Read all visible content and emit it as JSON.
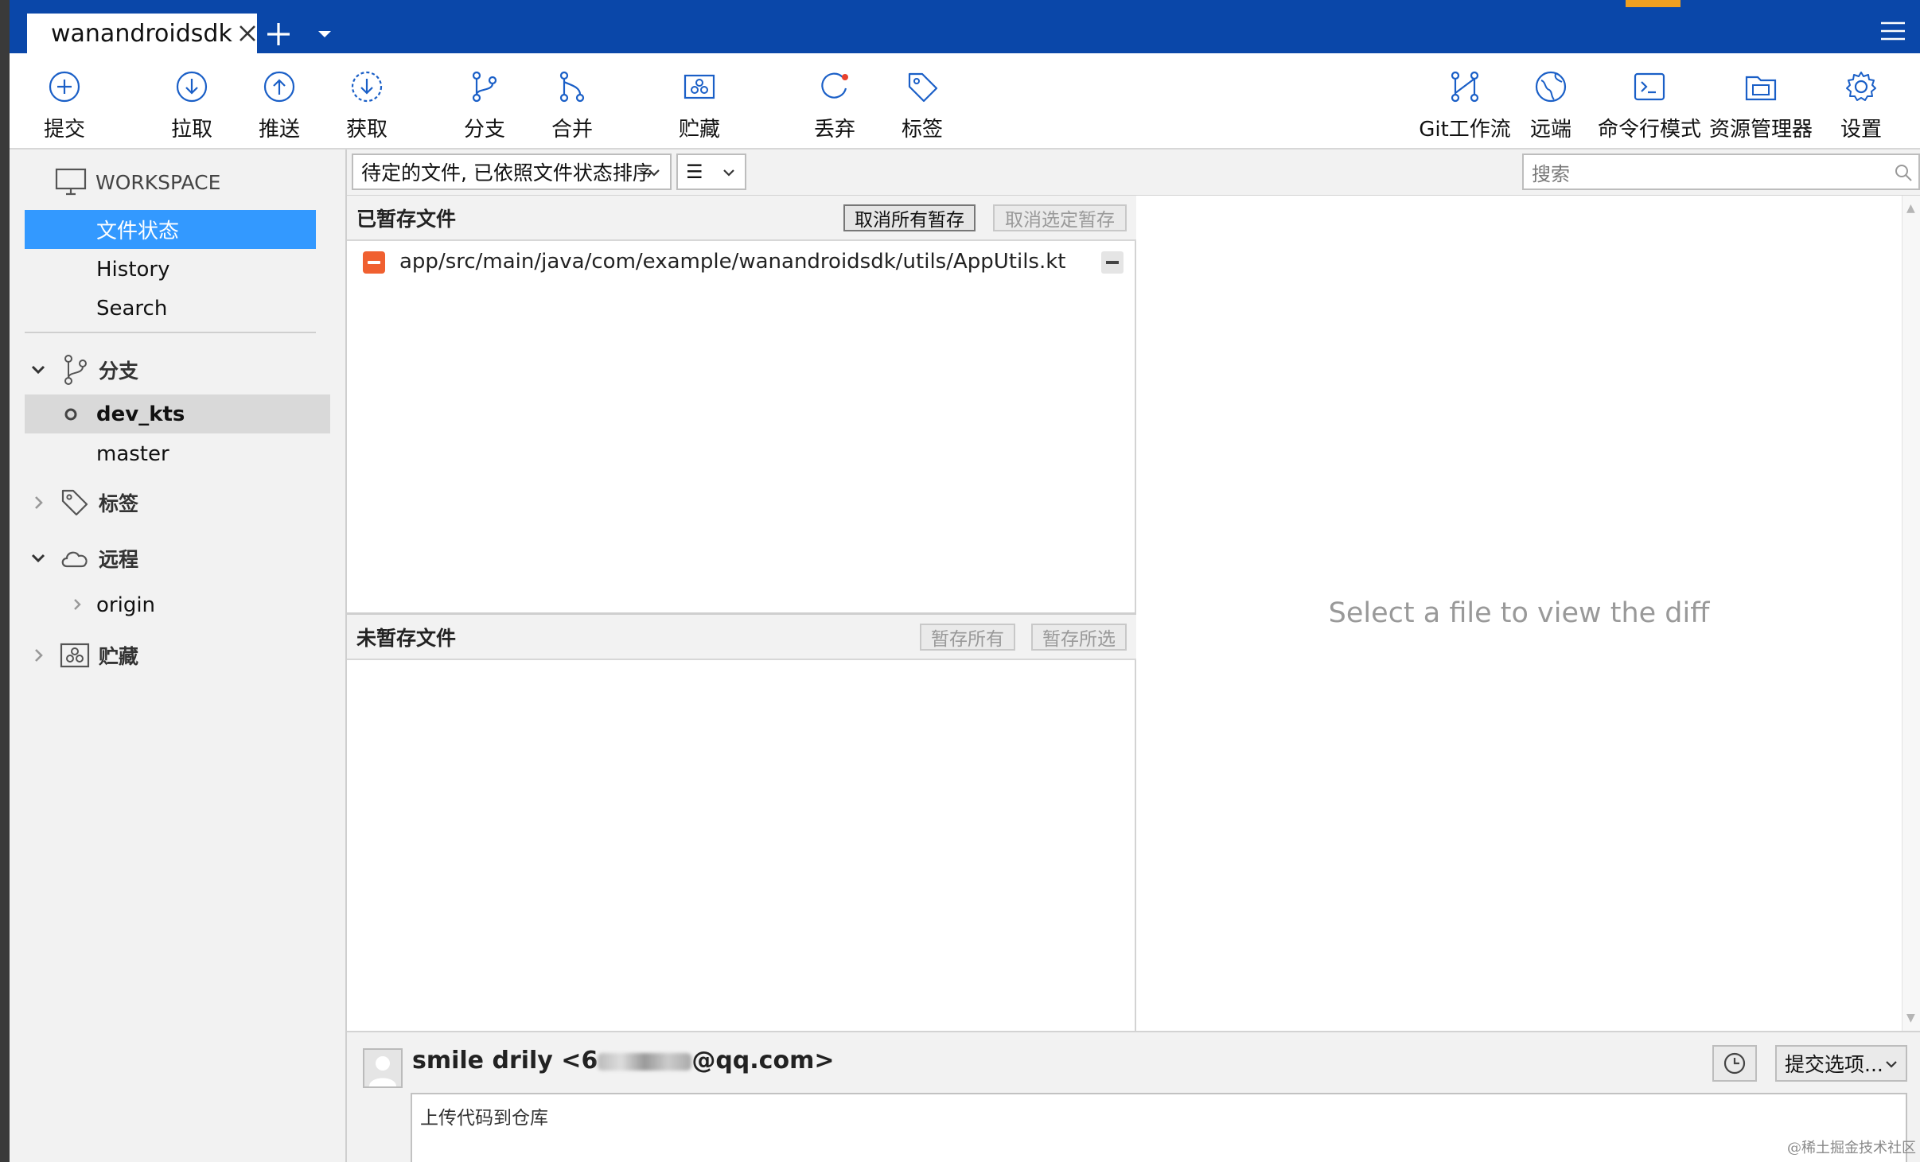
{
  "tabs": [
    {
      "title": "wanandroidsdk"
    }
  ],
  "toolbar": {
    "commit": "提交",
    "pull": "拉取",
    "push": "推送",
    "fetch": "获取",
    "branch": "分支",
    "merge": "合并",
    "stash": "贮藏",
    "discard": "丢弃",
    "tag": "标签",
    "git_flow": "Git工作流",
    "remote": "远端",
    "terminal": "命令行模式",
    "explorer": "资源管理器",
    "settings": "设置"
  },
  "sidebar": {
    "workspace": "WORKSPACE",
    "workspace_items": [
      "文件状态",
      "History",
      "Search"
    ],
    "branches_label": "分支",
    "branches": [
      "dev_kts",
      "master"
    ],
    "current_branch": "dev_kts",
    "tags_label": "标签",
    "remotes_label": "远程",
    "remotes": [
      "origin"
    ],
    "stashes_label": "贮藏"
  },
  "filter": {
    "view_mode": "待定的文件, 已依照文件状态排序",
    "list_icon": "☰",
    "search_placeholder": "搜索"
  },
  "staged": {
    "title": "已暂存文件",
    "unstage_all": "取消所有暂存",
    "unstage_selected": "取消选定暂存",
    "files": [
      {
        "path": "app/src/main/java/com/example/wanandroidsdk/utils/AppUtils.kt",
        "status": "removed"
      }
    ]
  },
  "unstaged": {
    "title": "未暂存文件",
    "stage_all": "暂存所有",
    "stage_selected": "暂存所选",
    "files": []
  },
  "diff": {
    "placeholder": "Select a file to view the diff"
  },
  "commit": {
    "author_prefix": "smile drily <6",
    "author_suffix": "@qq.com>",
    "options_label": "提交选项...",
    "message": "上传代码到仓库"
  },
  "watermark": "@稀土掘金技术社区",
  "colors": {
    "tabbar": "#0a47a9",
    "selection": "#3399ff",
    "accent_orange": "#f0a020",
    "removed_file": "#f06030",
    "icon_blue": "#1a5fc7"
  },
  "icons": {
    "commit": "plus-circle-icon",
    "pull": "arrow-down-circle-icon",
    "push": "arrow-up-circle-icon",
    "fetch": "dashed-arrow-down-circle-icon",
    "branch": "branch-icon",
    "merge": "merge-icon",
    "stash": "stash-box-icon",
    "discard": "refresh-discard-icon",
    "tag": "tag-icon",
    "git_flow": "git-flow-icon",
    "remote": "globe-icon",
    "terminal": "terminal-icon",
    "explorer": "folder-icon",
    "settings": "gear-icon"
  }
}
